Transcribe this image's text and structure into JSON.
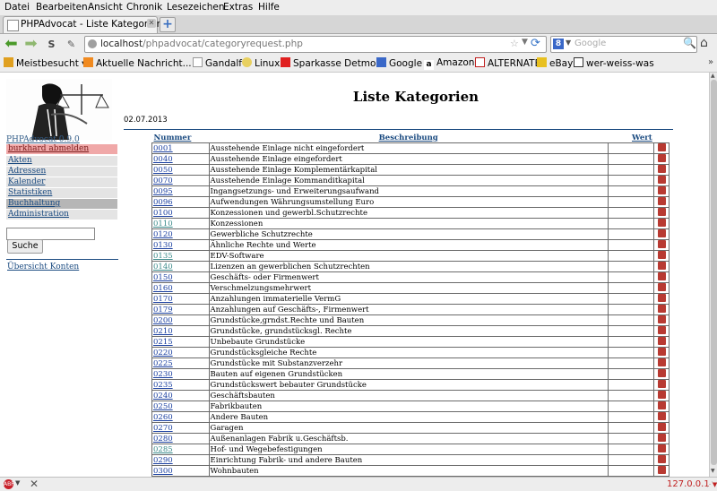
{
  "menu": [
    "Datei",
    "Bearbeiten",
    "Ansicht",
    "Chronik",
    "Lesezeichen",
    "Extras",
    "Hilfe"
  ],
  "tab": {
    "title": "PHPAdvocat - Liste Kategorien"
  },
  "nav": {
    "url_host": "localhost",
    "url_path": "/phpadvocat/categoryrequest.php",
    "search_placeholder": "Google",
    "search_engine_letter": "8"
  },
  "bookmarks": [
    {
      "label": "Meistbesucht",
      "icon": "folder-icon",
      "dropdown": true
    },
    {
      "label": "Aktuelle Nachricht...",
      "icon": "rss-icon",
      "dropdown": true
    },
    {
      "label": "Gandalf",
      "icon": "page-icon"
    },
    {
      "label": "Linux",
      "icon": "linux-icon"
    },
    {
      "label": "Sparkasse Detmold",
      "icon": "sparkasse-icon"
    },
    {
      "label": "Google",
      "icon": "google-icon"
    },
    {
      "label": "Amazon",
      "icon": "amazon-icon"
    },
    {
      "label": "ALTERNATE",
      "icon": "alternate-icon"
    },
    {
      "label": "eBay",
      "icon": "ebay-icon"
    },
    {
      "label": "wer-weiss-was",
      "icon": "www-icon"
    }
  ],
  "sidebar": {
    "version": "PHPAdvocat 0.9.0",
    "items": [
      {
        "label": "burkhard abmelden"
      },
      {
        "label": "Akten"
      },
      {
        "label": "Adressen"
      },
      {
        "label": "Kalender"
      },
      {
        "label": "Statistiken"
      },
      {
        "label": "Buchhaltung"
      },
      {
        "label": "Administration"
      }
    ],
    "search_value": "",
    "search_button": "Suche",
    "konten_link": "Übersicht Konten"
  },
  "main": {
    "title": "Liste Kategorien",
    "date": "02.07.2013",
    "columns": {
      "nr": "Nummer",
      "desc": "Beschreibung",
      "wert": "Wert"
    },
    "rows": [
      {
        "nr": "0001",
        "desc": "Ausstehende Einlage nicht eingefordert",
        "wert": "",
        "visited": false
      },
      {
        "nr": "0040",
        "desc": "Ausstehende Einlage eingefordert",
        "wert": "",
        "visited": false
      },
      {
        "nr": "0050",
        "desc": "Ausstehende Einlage Komplementärkapital",
        "wert": "",
        "visited": false
      },
      {
        "nr": "0070",
        "desc": "Ausstehende Einlage Kommanditkapital",
        "wert": "",
        "visited": false
      },
      {
        "nr": "0095",
        "desc": "Ingangsetzungs- und Erweiterungsaufwand",
        "wert": "",
        "visited": false
      },
      {
        "nr": "0096",
        "desc": "Aufwendungen Währungsumstellung Euro",
        "wert": "",
        "visited": false
      },
      {
        "nr": "0100",
        "desc": "Konzessionen und gewerbl.Schutzrechte",
        "wert": "",
        "visited": false
      },
      {
        "nr": "0110",
        "desc": "Konzessionen",
        "wert": "",
        "visited": true
      },
      {
        "nr": "0120",
        "desc": "Gewerbliche Schutzrechte",
        "wert": "",
        "visited": false
      },
      {
        "nr": "0130",
        "desc": "Ähnliche Rechte und Werte",
        "wert": "",
        "visited": false
      },
      {
        "nr": "0135",
        "desc": "EDV-Software",
        "wert": "",
        "visited": true
      },
      {
        "nr": "0140",
        "desc": "Lizenzen an gewerblichen Schutzrechten",
        "wert": "",
        "visited": true
      },
      {
        "nr": "0150",
        "desc": "Geschäfts- oder Firmenwert",
        "wert": "",
        "visited": false
      },
      {
        "nr": "0160",
        "desc": "Verschmelzungsmehrwert",
        "wert": "",
        "visited": false
      },
      {
        "nr": "0170",
        "desc": "Anzahlungen immaterielle VermG",
        "wert": "",
        "visited": false
      },
      {
        "nr": "0179",
        "desc": "Anzahlungen auf Geschäfts-, Firmenwert",
        "wert": "",
        "visited": false
      },
      {
        "nr": "0200",
        "desc": "Grundstücke,grndst.Rechte und Bauten",
        "wert": "",
        "visited": false
      },
      {
        "nr": "0210",
        "desc": "Grundstücke, grundstücksgl. Rechte",
        "wert": "",
        "visited": false
      },
      {
        "nr": "0215",
        "desc": "Unbebaute Grundstücke",
        "wert": "",
        "visited": false
      },
      {
        "nr": "0220",
        "desc": "Grundstücksgleiche Rechte",
        "wert": "",
        "visited": false
      },
      {
        "nr": "0225",
        "desc": "Grundstücke mit Substanzverzehr",
        "wert": "",
        "visited": false
      },
      {
        "nr": "0230",
        "desc": "Bauten auf eigenen Grundstücken",
        "wert": "",
        "visited": false
      },
      {
        "nr": "0235",
        "desc": "Grundstückswert bebauter Grundstücke",
        "wert": "",
        "visited": false
      },
      {
        "nr": "0240",
        "desc": "Geschäftsbauten",
        "wert": "",
        "visited": false
      },
      {
        "nr": "0250",
        "desc": "Fabrikbauten",
        "wert": "",
        "visited": false
      },
      {
        "nr": "0260",
        "desc": "Andere Bauten",
        "wert": "",
        "visited": false
      },
      {
        "nr": "0270",
        "desc": "Garagen",
        "wert": "",
        "visited": false
      },
      {
        "nr": "0280",
        "desc": "Außenanlagen Fabrik u.Geschäftsb.",
        "wert": "",
        "visited": false
      },
      {
        "nr": "0285",
        "desc": "Hof- und Wegebefestigungen",
        "wert": "",
        "visited": true
      },
      {
        "nr": "0290",
        "desc": "Einrichtung Fabrik- und andere Bauten",
        "wert": "",
        "visited": false
      },
      {
        "nr": "0300",
        "desc": "Wohnbauten",
        "wert": "",
        "visited": false
      }
    ]
  },
  "status": {
    "ip": "127.0.0.1",
    "ip_dropdown": "▼"
  },
  "colors": {
    "accent_link": "#1a3fa0",
    "visited_link": "#3a8a8a",
    "logout_bg": "#f0a8a8",
    "active_nav_bg": "#b6b6b6",
    "status_ip": "#c02020"
  }
}
